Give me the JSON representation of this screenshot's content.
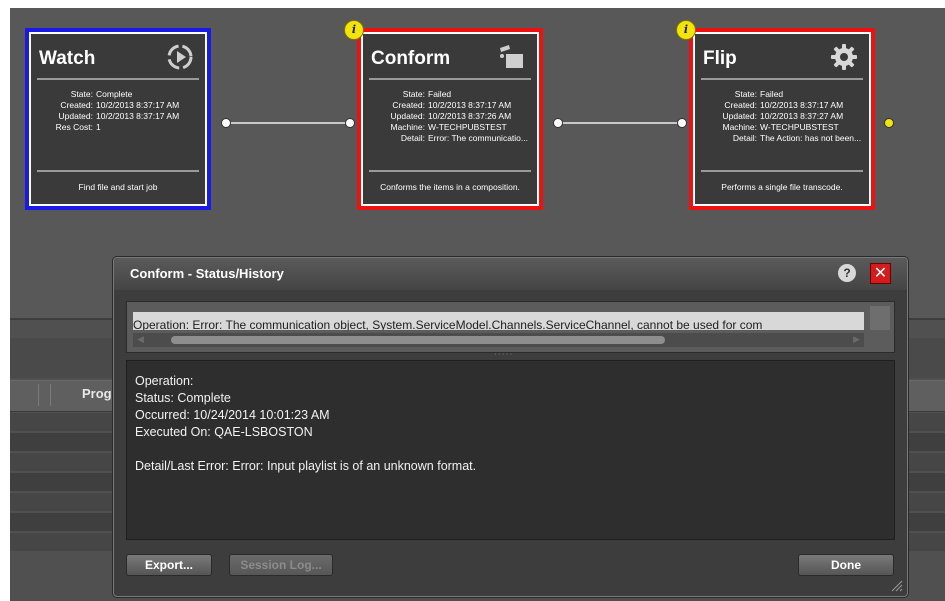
{
  "workflow": {
    "cards": [
      {
        "title": "Watch",
        "icon": "watch-play-icon",
        "status_color": "#1a1ae6",
        "meta": [
          {
            "k": "State:",
            "v": "Complete"
          },
          {
            "k": "Created:",
            "v": "10/2/2013 8:37:17 AM"
          },
          {
            "k": "Updated:",
            "v": "10/2/2013 8:37:17 AM"
          },
          {
            "k": "Res Cost:",
            "v": "1"
          }
        ],
        "description": "Find file and start job"
      },
      {
        "title": "Conform",
        "icon": "clapper-icon",
        "status_color": "#ee1111",
        "badge": "i",
        "meta": [
          {
            "k": "State:",
            "v": "Failed"
          },
          {
            "k": "Created:",
            "v": "10/2/2013 8:37:17 AM"
          },
          {
            "k": "Updated:",
            "v": "10/2/2013 8:37:26 AM"
          },
          {
            "k": "Machine:",
            "v": "W-TECHPUBSTEST"
          },
          {
            "k": "Detail:",
            "v": "Error: The communicatio..."
          }
        ],
        "description": "Conforms the items in a composition."
      },
      {
        "title": "Flip",
        "icon": "gear-icon",
        "status_color": "#ee1111",
        "badge": "i",
        "meta": [
          {
            "k": "State:",
            "v": "Failed"
          },
          {
            "k": "Created:",
            "v": "10/2/2013 8:37:17 AM"
          },
          {
            "k": "Updated:",
            "v": "10/2/2013 8:37:27 AM"
          },
          {
            "k": "Machine:",
            "v": "W-TECHPUBSTEST"
          },
          {
            "k": "Detail:",
            "v": "The Action:  has not been..."
          }
        ],
        "description": "Performs a single file transcode."
      }
    ]
  },
  "background": {
    "tab_label": "Prog"
  },
  "dialog": {
    "title": "Conform - Status/History",
    "help_label": "?",
    "close_label": "✕",
    "history_row": "Operation: Error: The communication object, System.ServiceModel.Channels.ServiceChannel, cannot be used for com",
    "detail": {
      "operation": "Operation:",
      "status": "Status: Complete",
      "occurred": "Occurred: 10/24/2014 10:01:23 AM",
      "executed_on": "Executed On: QAE-LSBOSTON",
      "last_error": "Detail/Last Error: Error: Input playlist is of an unknown format."
    },
    "buttons": {
      "export": "Export...",
      "session_log": "Session Log...",
      "done": "Done"
    }
  }
}
